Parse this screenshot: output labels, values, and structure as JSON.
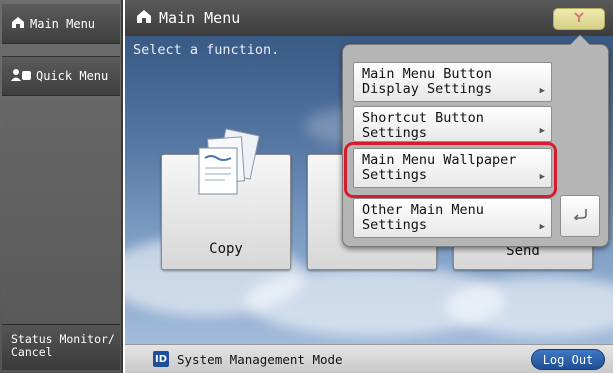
{
  "sidebar": {
    "main_menu_label": "Main Menu",
    "quick_menu_label": "Quick Menu",
    "status_label_line1": "Status Monitor/",
    "status_label_line2": "Cancel"
  },
  "header": {
    "title": "Main Menu"
  },
  "main": {
    "prompt": "Select a function.",
    "tiles": [
      {
        "label": "Copy"
      },
      {
        "label": "Send"
      }
    ]
  },
  "popup": {
    "items": [
      {
        "line1": "Main Menu Button",
        "line2": "Display Settings"
      },
      {
        "line1": "Shortcut Button",
        "line2": "Settings"
      },
      {
        "line1": "Main Menu Wallpaper",
        "line2": "Settings"
      },
      {
        "line1": "Other Main Menu",
        "line2": "Settings"
      }
    ]
  },
  "footer": {
    "id_badge": "ID",
    "mode": "System Management Mode",
    "logout": "Log Out"
  },
  "colors": {
    "highlight": "#d51d2f",
    "logout": "#2a5fab",
    "id_badge": "#1d4f9a"
  },
  "icons": {
    "home": "home-icon",
    "quick": "quick-menu-icon",
    "settings": "settings-icon",
    "back": "back-arrow-icon",
    "submenu": "submenu-arrow-icon"
  }
}
